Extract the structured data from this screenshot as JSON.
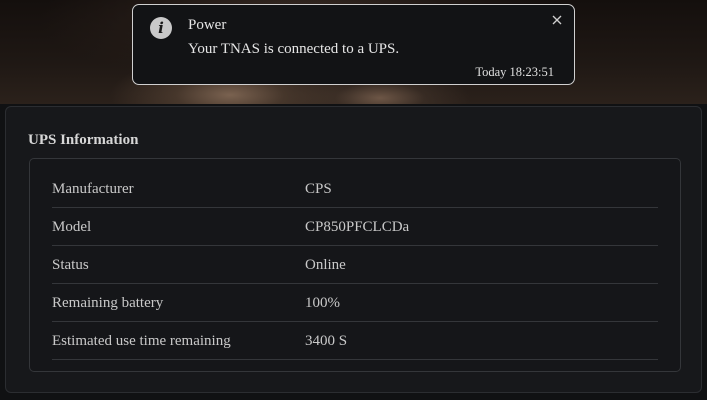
{
  "notification": {
    "title": "Power",
    "message": "Your TNAS is connected to a UPS.",
    "time": "Today 18:23:51",
    "icon": "info-icon",
    "close_icon": "close-icon"
  },
  "ups_panel": {
    "title": "UPS Information",
    "rows": [
      {
        "label": "Manufacturer",
        "value": "CPS"
      },
      {
        "label": "Model",
        "value": "CP850PFCLCDa"
      },
      {
        "label": "Status",
        "value": "Online"
      },
      {
        "label": "Remaining battery",
        "value": "100%"
      },
      {
        "label": "Estimated use time remaining",
        "value": "3400 S"
      }
    ]
  }
}
